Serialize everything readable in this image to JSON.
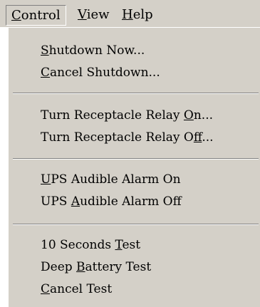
{
  "menubar": {
    "items": [
      {
        "pre": "",
        "key": "C",
        "post": "ontrol"
      },
      {
        "pre": "",
        "key": "V",
        "post": "iew"
      },
      {
        "pre": "",
        "key": "H",
        "post": "elp"
      }
    ]
  },
  "menu": {
    "items": [
      {
        "pre": "",
        "key": "S",
        "post": "hutdown Now..."
      },
      {
        "pre": "",
        "key": "C",
        "post": "ancel Shutdown..."
      },
      {
        "pre": "Turn Receptacle Relay ",
        "key": "O",
        "post": "n..."
      },
      {
        "pre": "Turn Receptacle Relay O",
        "key": "f",
        "post": "f..."
      },
      {
        "pre": "",
        "key": "U",
        "post": "PS Audible Alarm On"
      },
      {
        "pre": "UPS ",
        "key": "A",
        "post": "udible Alarm Off"
      },
      {
        "pre": "10 Seconds ",
        "key": "T",
        "post": "est"
      },
      {
        "pre": "Deep ",
        "key": "B",
        "post": "attery Test"
      },
      {
        "pre": "",
        "key": "C",
        "post": "ancel Test"
      }
    ]
  }
}
